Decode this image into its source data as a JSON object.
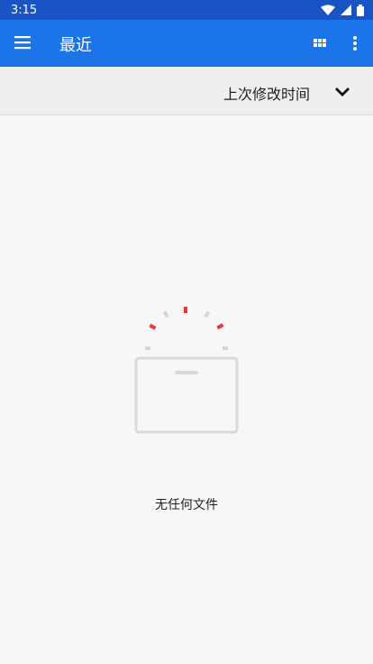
{
  "status_bar": {
    "time": "3:15"
  },
  "app_bar": {
    "title": "最近",
    "menu_icon": "menu-icon",
    "grid_icon": "grid-view-icon",
    "more_icon": "more-vert-icon",
    "color": "#1b74e8"
  },
  "sort": {
    "label": "上次修改时间",
    "chevron_icon": "chevron-down-icon"
  },
  "empty_state": {
    "message": "无任何文件",
    "illustration_icon": "empty-box-icon",
    "accent_color": "#e53935"
  }
}
